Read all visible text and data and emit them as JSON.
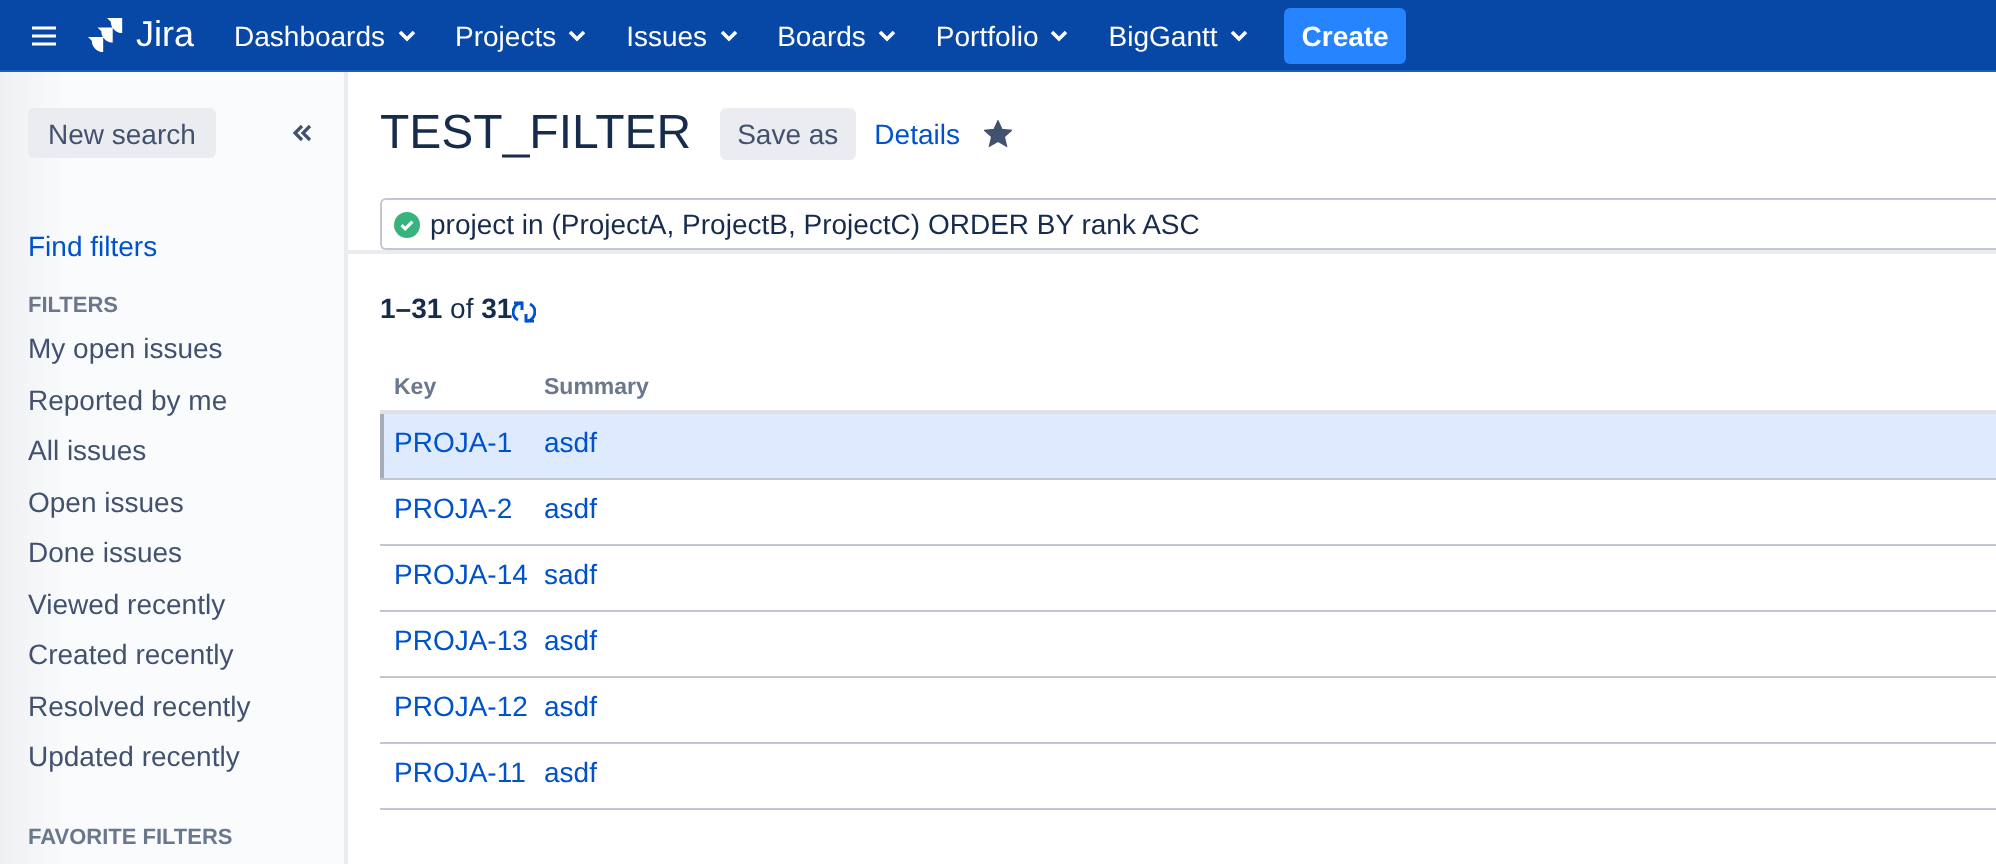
{
  "nav": {
    "logo": "Jira",
    "menus": [
      {
        "label": "Dashboards"
      },
      {
        "label": "Projects"
      },
      {
        "label": "Issues"
      },
      {
        "label": "Boards"
      },
      {
        "label": "Portfolio"
      },
      {
        "label": "BigGantt"
      }
    ],
    "create": "Create"
  },
  "sidebar": {
    "new_search": "New search",
    "find_filters": "Find filters",
    "filters_heading": "FILTERS",
    "items": [
      "My open issues",
      "Reported by me",
      "All issues",
      "Open issues",
      "Done issues",
      "Viewed recently",
      "Created recently",
      "Resolved recently",
      "Updated recently"
    ],
    "favorites_heading": "FAVORITE FILTERS"
  },
  "header": {
    "title": "TEST_FILTER",
    "save_as": "Save as",
    "details": "Details",
    "starred": true
  },
  "query": {
    "valid": true,
    "value": "project in (ProjectA, ProjectB, ProjectC) ORDER BY rank ASC"
  },
  "results": {
    "count": "**1–31** of **31**"
  },
  "table": {
    "columns": [
      "Key",
      "Summary"
    ],
    "rows": [
      {
        "key": "PROJA-1",
        "summary": "asdf",
        "selected": true
      },
      {
        "key": "PROJA-2",
        "summary": "asdf",
        "selected": false
      },
      {
        "key": "PROJA-14",
        "summary": "sadf",
        "selected": false
      },
      {
        "key": "PROJA-13",
        "summary": "asdf",
        "selected": false
      },
      {
        "key": "PROJA-12",
        "summary": "asdf",
        "selected": false
      },
      {
        "key": "PROJA-11",
        "summary": "asdf",
        "selected": false
      }
    ]
  }
}
